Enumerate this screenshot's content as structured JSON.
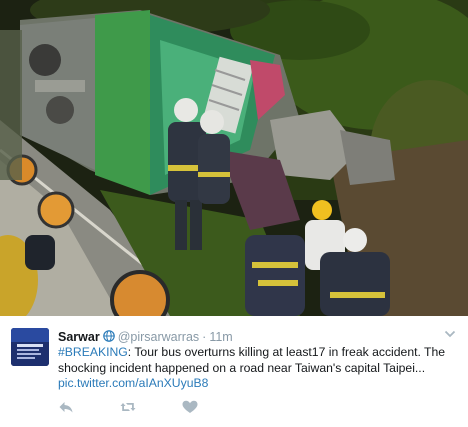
{
  "tweet": {
    "author": {
      "display_name": "Sarwar",
      "handle": "@pirsarwarras"
    },
    "separator": "·",
    "timestamp": "11m",
    "hashtag": "#BREAKING",
    "text": ": Tour bus overturns killing at least17 in freak accident. The shocking incident happened on a road near Taiwan's capital Taipei...",
    "link": "pic.twitter.com/aIAnXUyuB8",
    "actions": [
      "reply-icon",
      "retweet-icon",
      "like-icon"
    ],
    "colors": {
      "link": "#2b7bb9",
      "muted": "#8899a6",
      "text": "#14171a",
      "action": "#aab8c2"
    },
    "media": {
      "alt_icon": "photo-accident-scene"
    }
  }
}
